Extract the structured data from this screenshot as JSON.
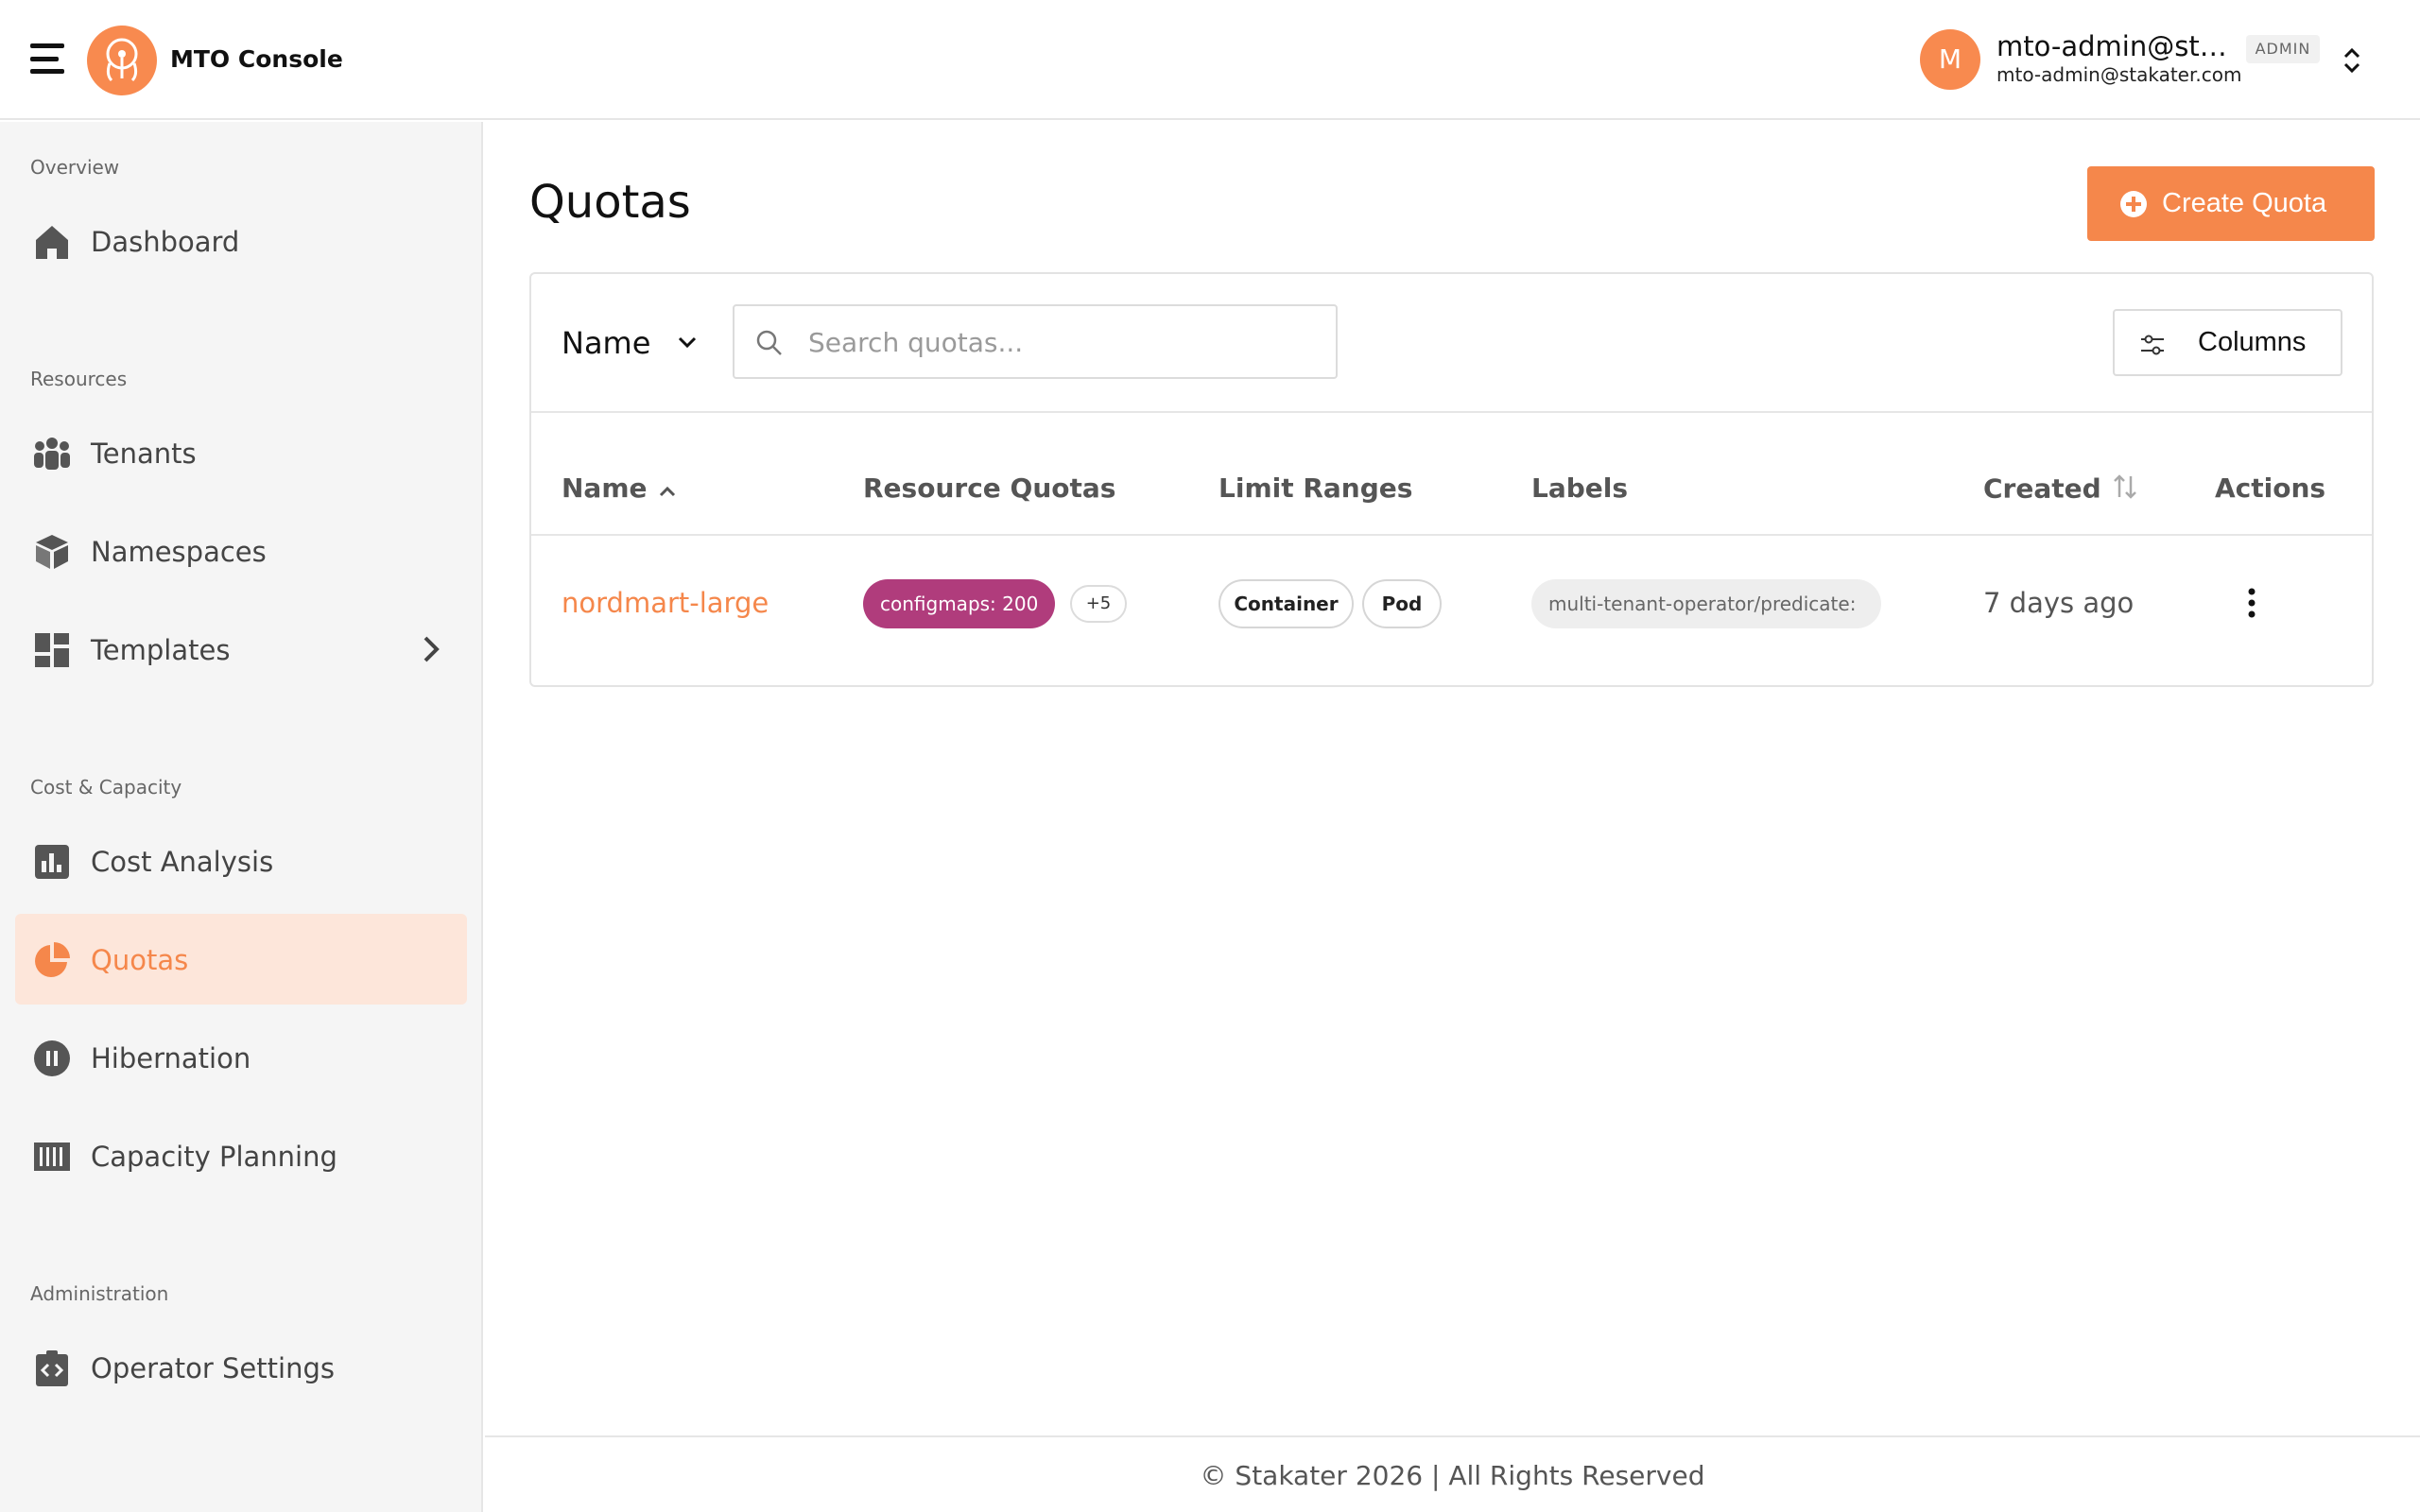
{
  "header": {
    "app_title": "MTO Console",
    "avatar_initial": "M",
    "user_name": "mto-admin@sta...",
    "role_badge": "ADMIN",
    "user_email": "mto-admin@stakater.com"
  },
  "sidebar": {
    "sections": [
      {
        "label": "Overview",
        "items": [
          {
            "label": "Dashboard",
            "icon": "home-icon"
          }
        ]
      },
      {
        "label": "Resources",
        "items": [
          {
            "label": "Tenants",
            "icon": "people-icon"
          },
          {
            "label": "Namespaces",
            "icon": "box-icon"
          },
          {
            "label": "Templates",
            "icon": "dashboard-grid-icon"
          }
        ]
      },
      {
        "label": "Cost & Capacity",
        "items": [
          {
            "label": "Cost Analysis",
            "icon": "bar-chart-icon"
          },
          {
            "label": "Quotas",
            "icon": "pie-chart-icon",
            "active": true
          },
          {
            "label": "Hibernation",
            "icon": "pause-circle-icon"
          },
          {
            "label": "Capacity Planning",
            "icon": "barcode-icon"
          }
        ]
      },
      {
        "label": "Administration",
        "items": [
          {
            "label": "Operator Settings",
            "icon": "code-clipboard-icon"
          }
        ]
      }
    ]
  },
  "main": {
    "title": "Quotas",
    "create_button": "Create Quota",
    "filter_field": "Name",
    "search_placeholder": "Search quotas...",
    "columns_button": "Columns",
    "table": {
      "headers": [
        "Name",
        "Resource Quotas",
        "Limit Ranges",
        "Labels",
        "Created",
        "Actions"
      ],
      "rows": [
        {
          "name": "nordmart-large",
          "resource_quota_chip": "configmaps: 200",
          "resource_quota_more": "+5",
          "limit_ranges": [
            "Container",
            "Pod"
          ],
          "label": "multi-tenant-operator/predicate:",
          "created": "7 days ago"
        }
      ]
    }
  },
  "footer": {
    "text": "© Stakater 2026 | All Rights Reserved"
  },
  "colors": {
    "accent": "#f5874b",
    "active_bg": "#fde6da",
    "quota_chip": "#b03c7c"
  }
}
